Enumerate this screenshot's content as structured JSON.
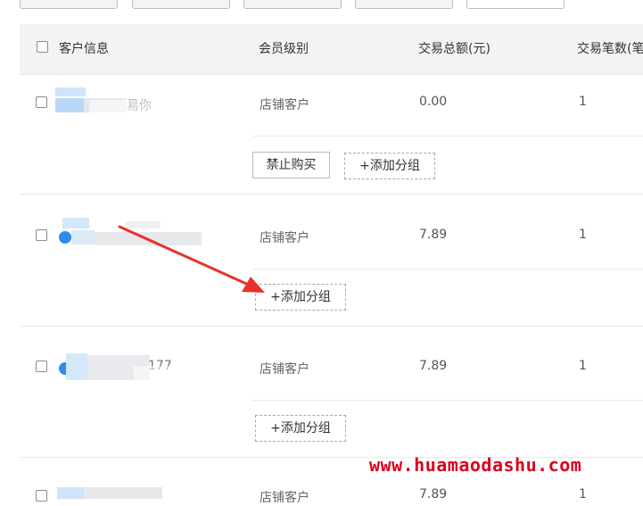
{
  "header": {
    "customer_info": "客户信息",
    "member_level": "会员级别",
    "total_amount": "交易总额(元)",
    "trade_count": "交易笔数(笔"
  },
  "rows": [
    {
      "name_fragment": "易你",
      "level": "店铺客户",
      "amount": "0.00",
      "count": "1",
      "ban_button": "禁止购买",
      "add_group_button": "+添加分组"
    },
    {
      "name_fragment": "",
      "level": "店铺客户",
      "amount": "7.89",
      "count": "1",
      "add_group_button": "+添加分组"
    },
    {
      "name_fragment": "177",
      "level": "店铺客户",
      "amount": "7.89",
      "count": "1",
      "add_group_button": "+添加分组"
    },
    {
      "name_fragment": "",
      "level": "店铺客户",
      "amount": "7.89",
      "count": "1"
    }
  ],
  "colors": {
    "header_bg": "#f2f3f5",
    "arrow": "#e8312a",
    "avatar": "#2d8cf0",
    "watermark": "#d9001b"
  },
  "watermark": "www.huamaodashu.com"
}
